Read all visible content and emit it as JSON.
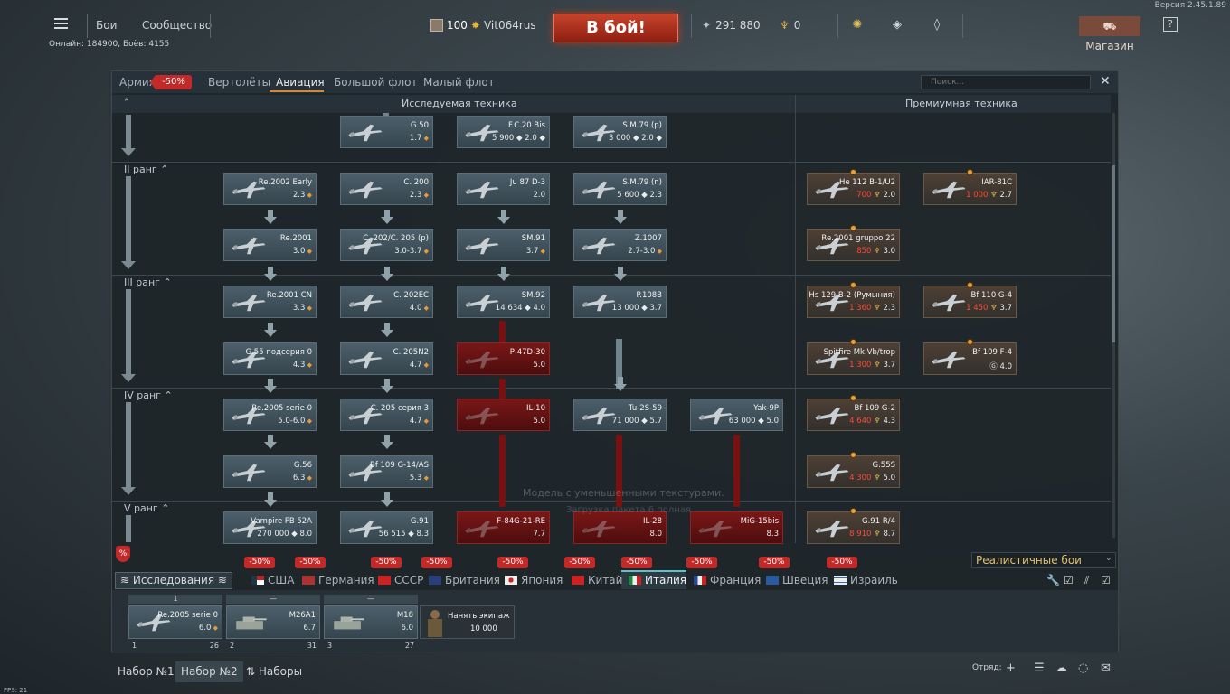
{
  "version": "Версия 2.45.1.89",
  "topbar": {
    "nav": [
      "Бои",
      "Сообщество"
    ],
    "player_level": "100",
    "player_name": "Vit064rus",
    "battle_button": "В бой!",
    "silver_lions": "291 880",
    "golden_eagles": "0",
    "shop": "Магазин",
    "help": "?",
    "online": "Онлайн: 184900, Боёв: 4155"
  },
  "tabs": {
    "items": [
      "Армия",
      "Вертолёты",
      "Авиация",
      "Большой флот",
      "Малый флот"
    ],
    "army_discount": "-50%",
    "active": "Авиация",
    "search_placeholder": "Поиск..."
  },
  "sections": {
    "researched": "Исследуемая техника",
    "premium": "Премиумная техника"
  },
  "ranks": [
    "II ранг",
    "III ранг",
    "IV ранг",
    "V ранг"
  ],
  "tree": {
    "row0": [
      {
        "name": "G.50",
        "info": "1.7",
        "br": true
      },
      {
        "name": "F.C.20 Bis",
        "info": "5 900 ◆ 2.0 ◆"
      },
      {
        "name": "S.M.79 (p)",
        "info": "3 000 ◆ 2.0 ◆"
      }
    ],
    "row1": [
      {
        "name": "Re.2002 Early",
        "info": "2.3"
      },
      {
        "name": "C. 200",
        "info": "2.3"
      },
      {
        "name": "Ju 87 D-3",
        "info": "2.0"
      },
      {
        "name": "S.M.79 (n)",
        "info": "5 600 ◆ 2.3"
      }
    ],
    "row2": [
      {
        "name": "Re.2001",
        "info": "3.0"
      },
      {
        "name": "C. 202/C. 205 (p)",
        "info": "3.0-3.7"
      },
      {
        "name": "SM.91",
        "info": "3.7"
      },
      {
        "name": "Z.1007",
        "info": "2.7-3.0"
      }
    ],
    "row3": [
      {
        "name": "Re.2001 CN",
        "info": "3.3"
      },
      {
        "name": "C. 202EC",
        "info": "4.0"
      },
      {
        "name": "SM.92",
        "info": "14 634 ◆ 4.0"
      },
      {
        "name": "P.108B",
        "info": "13 000 ◆ 3.7"
      }
    ],
    "row4": [
      {
        "name": "G.55 подсерия 0",
        "info": "4.3"
      },
      {
        "name": "C. 205N2",
        "info": "4.7"
      },
      {
        "name": "P-47D-30",
        "info": "5.0"
      }
    ],
    "row5": [
      {
        "name": "Re.2005 serie 0",
        "info": "5.0-6.0"
      },
      {
        "name": "C. 205 серия 3",
        "info": "4.7"
      },
      {
        "name": "IL-10",
        "info": "5.0"
      },
      {
        "name": "Tu-2S-59",
        "info": "71 000 ◆ 5.7"
      },
      {
        "name": "Yak-9P",
        "info": "63 000 ◆ 5.0"
      }
    ],
    "row6": [
      {
        "name": "G.56",
        "info": "6.3"
      },
      {
        "name": "Bf 109 G-14/AS",
        "info": "5.3"
      }
    ],
    "row7": [
      {
        "name": "Vampire FB 52A",
        "info": "270 000 ◆ 8.0"
      },
      {
        "name": "G.91",
        "info": "56 515 ◆ 8.3"
      },
      {
        "name": "F-84G-21-RE",
        "info": "7.7"
      },
      {
        "name": "IL-28",
        "info": "8.0"
      },
      {
        "name": "MiG-15bis",
        "info": "8.3"
      }
    ]
  },
  "premium": {
    "p1": {
      "name": "He 112 B-1/U2",
      "price": "700",
      "br": "2.0"
    },
    "p2": {
      "name": "IAR-81C",
      "price": "1 000",
      "br": "2.7"
    },
    "p3": {
      "name": "Re.2001 gruppo 22",
      "price": "850",
      "br": "3.0"
    },
    "p4": {
      "name": "Hs 129 B-2 (Румыния)",
      "price": "1 360",
      "br": "2.3"
    },
    "p5": {
      "name": "Bf 110 G-4",
      "price": "1 450",
      "br": "3.7"
    },
    "p6": {
      "name": "Spitfire Mk.Vb/trop",
      "price": "1 300",
      "br": "3.7"
    },
    "p7": {
      "name": "Bf 109 F-4",
      "price": "Ⓖ",
      "br": "4.0"
    },
    "p8": {
      "name": "Bf 109 G-2",
      "price": "4 640",
      "br": "4.3"
    },
    "p9": {
      "name": "G.55S",
      "price": "4 300",
      "br": "5.0"
    },
    "p10": {
      "name": "G.91 R/4",
      "price": "8 910",
      "br": "8.7"
    }
  },
  "watermark": {
    "line1": "Модель с уменьшенными текстурами.",
    "line2": "Загрузка пакета 6 полная"
  },
  "nations": {
    "research_button": "Исследования",
    "items": [
      "США",
      "Германия",
      "СССР",
      "Британия",
      "Япония",
      "Китай",
      "Италия",
      "Франция",
      "Швеция",
      "Израиль"
    ],
    "discount": "-50%",
    "active": "Италия",
    "mode": "Реалистичные бои"
  },
  "slots": [
    {
      "top": "1",
      "name": "Re.2005 serie 0",
      "br": "6.0",
      "crew": "1",
      "crew_value": "26"
    },
    {
      "top": "—",
      "name": "M26A1",
      "br": "6.7",
      "crew": "2",
      "crew_value": "31"
    },
    {
      "top": "—",
      "name": "M18",
      "br": "6.0",
      "crew": "3",
      "crew_value": "27"
    }
  ],
  "hire": {
    "label": "Нанять экипаж",
    "cost": "10 000"
  },
  "bottombar": {
    "preset1": "Набор №1",
    "preset2": "Набор №2",
    "presets": "Наборы",
    "squad": "Отряд:",
    "fps": "FPS: 21"
  },
  "colors": {
    "accent_orange": "#d28a3a",
    "locked_red": "#7a1010",
    "discount_red": "#c22a2a",
    "battle_btn": "#c7432a"
  }
}
